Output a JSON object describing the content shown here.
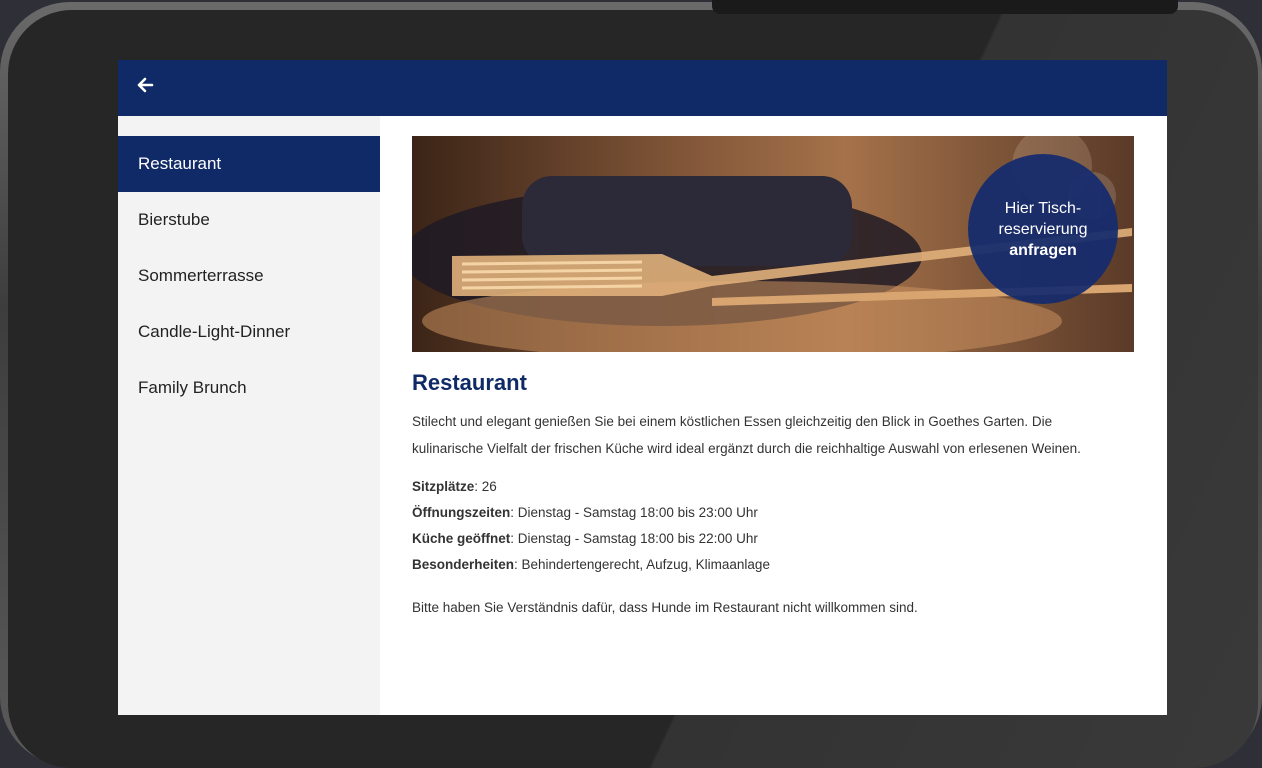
{
  "header": {
    "back_icon": "arrow-left-icon"
  },
  "sidebar": {
    "items": [
      {
        "label": "Restaurant",
        "active": true
      },
      {
        "label": "Bierstube",
        "active": false
      },
      {
        "label": "Sommerterrasse",
        "active": false
      },
      {
        "label": "Candle-Light-Dinner",
        "active": false
      },
      {
        "label": "Family Brunch",
        "active": false
      }
    ]
  },
  "hero": {
    "cta_line1": "Hier Tisch-",
    "cta_line2": "reservierung",
    "cta_line3": "anfragen"
  },
  "main": {
    "title": "Restaurant",
    "description": "Stilecht und elegant genießen Sie bei einem köstlichen Essen gleichzeitig den Blick in Goethes Garten. Die kulinarische Vielfalt der frischen Küche wird ideal ergänzt durch die reichhaltige Auswahl von erlesenen Weinen.",
    "facts": [
      {
        "label": "Sitzplätze",
        "value": ": 26"
      },
      {
        "label": "Öffnungszeiten",
        "value": ": Dienstag - Samstag 18:00 bis 23:00 Uhr"
      },
      {
        "label": "Küche geöffnet",
        "value": ": Dienstag - Samstag 18:00 bis 22:00 Uhr"
      },
      {
        "label": "Besonderheiten",
        "value": ": Behindertengerecht, Aufzug, Klimaanlage"
      }
    ],
    "note": "Bitte haben Sie Verständnis dafür, dass Hunde im Restaurant nicht willkommen sind."
  },
  "colors": {
    "brand": "#0f2a66",
    "sidebar_bg": "#f3f3f3"
  }
}
